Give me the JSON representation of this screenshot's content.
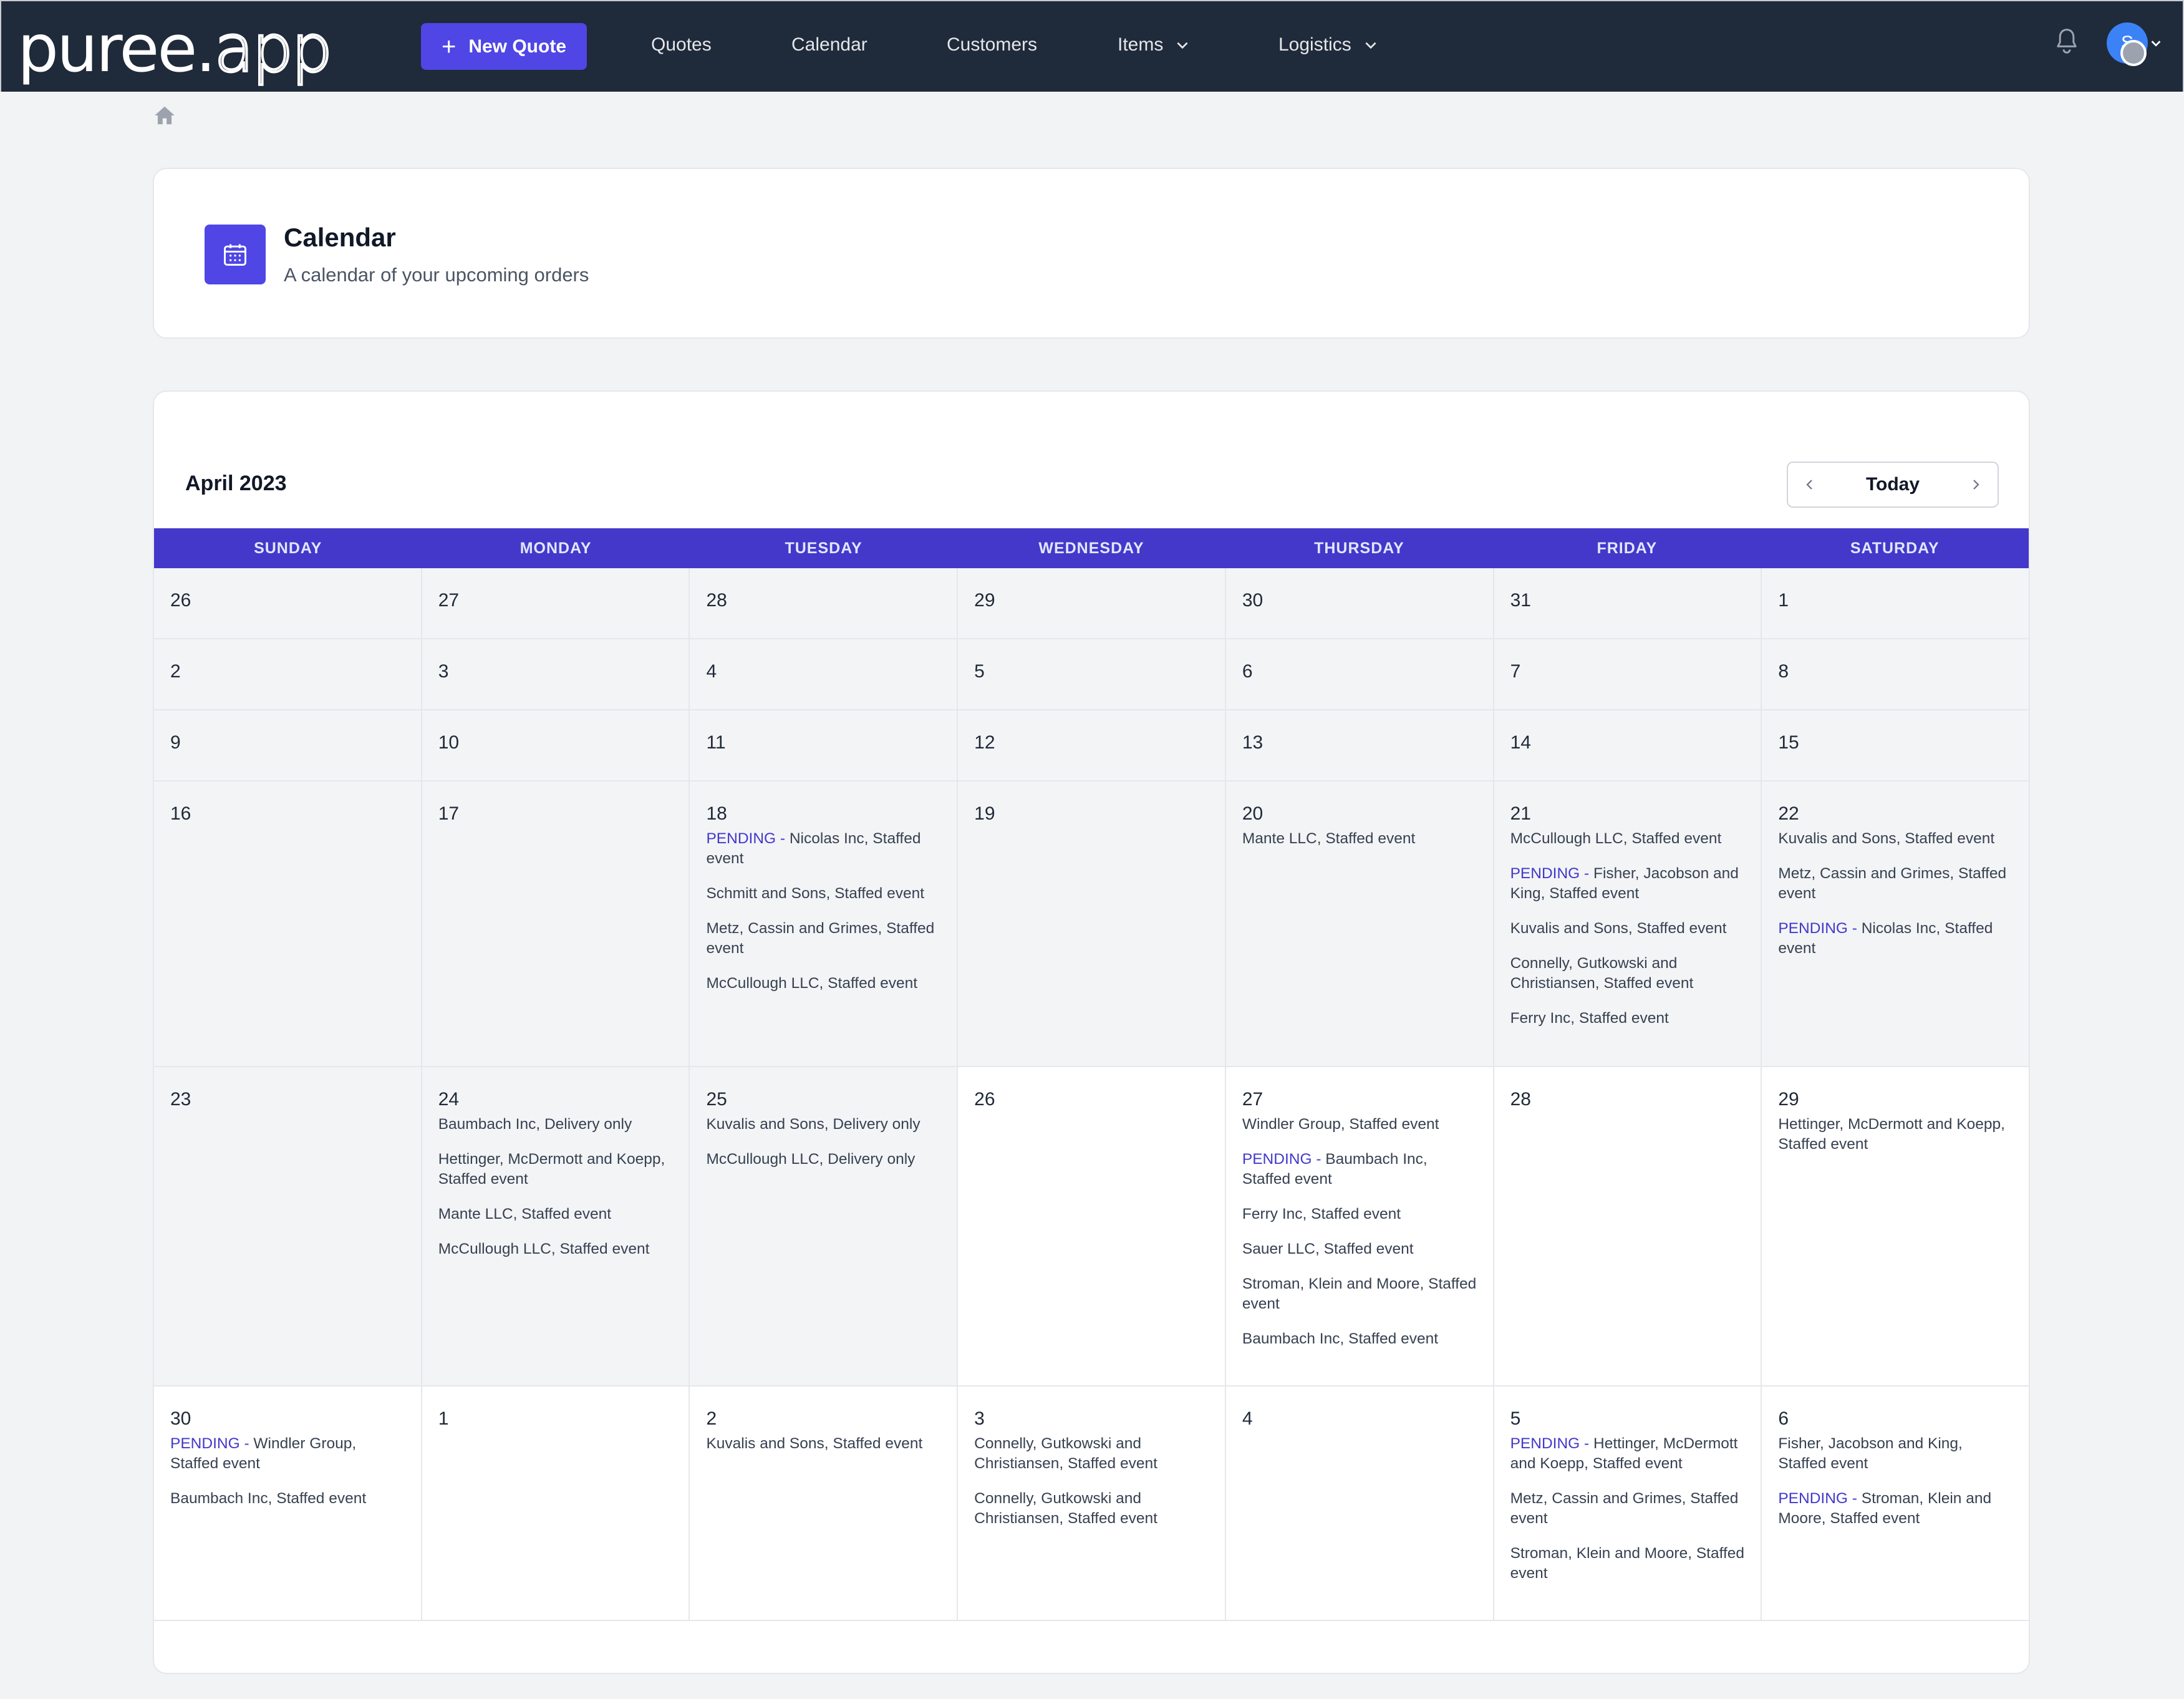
{
  "brand": {
    "name_main": "puree",
    "name_dot": ".",
    "name_tld": "app"
  },
  "nav": {
    "new_quote": "New Quote",
    "links": [
      "Quotes",
      "Calendar",
      "Customers",
      "Items",
      "Logistics"
    ]
  },
  "user": {
    "avatar_initial": "S"
  },
  "header": {
    "title": "Calendar",
    "subtitle": "A calendar of your upcoming orders"
  },
  "calendar": {
    "month_label": "April 2023",
    "today_label": "Today",
    "weekdays": [
      "SUNDAY",
      "MONDAY",
      "TUESDAY",
      "WEDNESDAY",
      "THURSDAY",
      "FRIDAY",
      "SATURDAY"
    ],
    "pending_label": "PENDING",
    "weeks": [
      {
        "days": [
          {
            "day": "26",
            "current": false,
            "events": []
          },
          {
            "day": "27",
            "current": false,
            "events": []
          },
          {
            "day": "28",
            "current": false,
            "events": []
          },
          {
            "day": "29",
            "current": false,
            "events": []
          },
          {
            "day": "30",
            "current": false,
            "events": []
          },
          {
            "day": "31",
            "current": false,
            "events": []
          },
          {
            "day": "1",
            "current": false,
            "events": []
          }
        ]
      },
      {
        "days": [
          {
            "day": "2",
            "current": false,
            "events": []
          },
          {
            "day": "3",
            "current": false,
            "events": []
          },
          {
            "day": "4",
            "current": false,
            "events": []
          },
          {
            "day": "5",
            "current": false,
            "events": []
          },
          {
            "day": "6",
            "current": false,
            "events": []
          },
          {
            "day": "7",
            "current": false,
            "events": []
          },
          {
            "day": "8",
            "current": false,
            "events": []
          }
        ]
      },
      {
        "days": [
          {
            "day": "9",
            "current": false,
            "events": []
          },
          {
            "day": "10",
            "current": false,
            "events": []
          },
          {
            "day": "11",
            "current": false,
            "events": []
          },
          {
            "day": "12",
            "current": false,
            "events": []
          },
          {
            "day": "13",
            "current": false,
            "events": []
          },
          {
            "day": "14",
            "current": false,
            "events": []
          },
          {
            "day": "15",
            "current": false,
            "events": []
          }
        ]
      },
      {
        "days": [
          {
            "day": "16",
            "current": false,
            "events": []
          },
          {
            "day": "17",
            "current": false,
            "events": []
          },
          {
            "day": "18",
            "current": false,
            "events": [
              {
                "pending": true,
                "text": "Nicolas Inc, Staffed event"
              },
              {
                "pending": false,
                "text": "Schmitt and Sons, Staffed event"
              },
              {
                "pending": false,
                "text": "Metz, Cassin and Grimes, Staffed event"
              },
              {
                "pending": false,
                "text": "McCullough LLC, Staffed event"
              }
            ]
          },
          {
            "day": "19",
            "current": false,
            "events": []
          },
          {
            "day": "20",
            "current": false,
            "events": [
              {
                "pending": false,
                "text": "Mante LLC, Staffed event"
              }
            ]
          },
          {
            "day": "21",
            "current": false,
            "events": [
              {
                "pending": false,
                "text": "McCullough LLC, Staffed event"
              },
              {
                "pending": true,
                "text": "Fisher, Jacobson and King, Staffed event"
              },
              {
                "pending": false,
                "text": "Kuvalis and Sons, Staffed event"
              },
              {
                "pending": false,
                "text": "Connelly, Gutkowski and Christiansen, Staffed event"
              },
              {
                "pending": false,
                "text": "Ferry Inc, Staffed event"
              }
            ]
          },
          {
            "day": "22",
            "current": false,
            "events": [
              {
                "pending": false,
                "text": "Kuvalis and Sons, Staffed event"
              },
              {
                "pending": false,
                "text": "Metz, Cassin and Grimes, Staffed event"
              },
              {
                "pending": true,
                "text": "Nicolas Inc, Staffed event"
              }
            ]
          }
        ]
      },
      {
        "days": [
          {
            "day": "23",
            "current": false,
            "events": []
          },
          {
            "day": "24",
            "current": false,
            "events": [
              {
                "pending": false,
                "text": "Baumbach Inc, Delivery only"
              },
              {
                "pending": false,
                "text": "Hettinger, McDermott and Koepp, Staffed event"
              },
              {
                "pending": false,
                "text": "Mante LLC, Staffed event"
              },
              {
                "pending": false,
                "text": "McCullough LLC, Staffed event"
              }
            ]
          },
          {
            "day": "25",
            "current": false,
            "events": [
              {
                "pending": false,
                "text": "Kuvalis and Sons, Delivery only"
              },
              {
                "pending": false,
                "text": "McCullough LLC, Delivery only"
              }
            ]
          },
          {
            "day": "26",
            "current": true,
            "events": []
          },
          {
            "day": "27",
            "current": true,
            "events": [
              {
                "pending": false,
                "text": "Windler Group, Staffed event"
              },
              {
                "pending": true,
                "text": "Baumbach Inc, Staffed event"
              },
              {
                "pending": false,
                "text": "Ferry Inc, Staffed event"
              },
              {
                "pending": false,
                "text": "Sauer LLC, Staffed event"
              },
              {
                "pending": false,
                "text": "Stroman, Klein and Moore, Staffed event"
              },
              {
                "pending": false,
                "text": "Baumbach Inc, Staffed event"
              }
            ]
          },
          {
            "day": "28",
            "current": true,
            "events": []
          },
          {
            "day": "29",
            "current": true,
            "events": [
              {
                "pending": false,
                "text": "Hettinger, McDermott and Koepp, Staffed event"
              }
            ]
          }
        ]
      },
      {
        "days": [
          {
            "day": "30",
            "current": true,
            "events": [
              {
                "pending": true,
                "text": "Windler Group, Staffed event"
              },
              {
                "pending": false,
                "text": "Baumbach Inc, Staffed event"
              }
            ]
          },
          {
            "day": "1",
            "current": true,
            "events": []
          },
          {
            "day": "2",
            "current": true,
            "events": [
              {
                "pending": false,
                "text": "Kuvalis and Sons, Staffed event"
              }
            ]
          },
          {
            "day": "3",
            "current": true,
            "events": [
              {
                "pending": false,
                "text": "Connelly, Gutkowski and Christiansen, Staffed event"
              },
              {
                "pending": false,
                "text": "Connelly, Gutkowski and Christiansen, Staffed event"
              }
            ]
          },
          {
            "day": "4",
            "current": true,
            "events": []
          },
          {
            "day": "5",
            "current": true,
            "events": [
              {
                "pending": true,
                "text": "Hettinger, McDermott and Koepp, Staffed event"
              },
              {
                "pending": false,
                "text": "Metz, Cassin and Grimes, Staffed event"
              },
              {
                "pending": false,
                "text": "Stroman, Klein and Moore, Staffed event"
              }
            ]
          },
          {
            "day": "6",
            "current": true,
            "events": [
              {
                "pending": false,
                "text": "Fisher, Jacobson and King, Staffed event"
              },
              {
                "pending": true,
                "text": "Stroman, Klein and Moore, Staffed event"
              }
            ]
          }
        ]
      }
    ]
  }
}
